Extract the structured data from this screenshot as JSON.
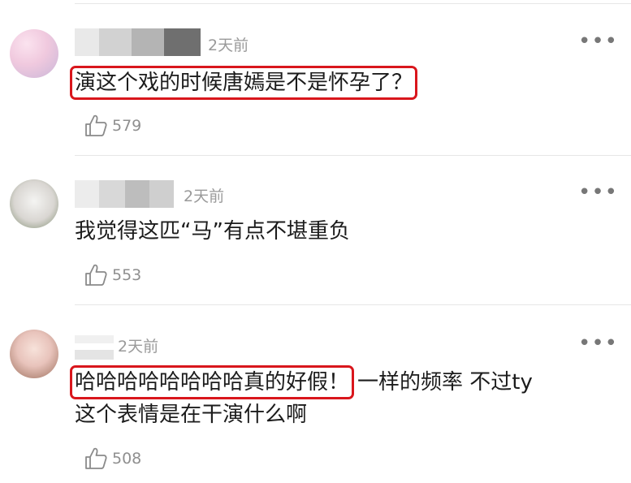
{
  "comments": [
    {
      "time": "2天前",
      "text_highlight": "演这个戏的时候唐嫣是不是怀孕了？",
      "text_rest": "",
      "text_line2": "",
      "likes": "579"
    },
    {
      "time": "2天前",
      "text_highlight": "",
      "text_rest": "我觉得这匹“马”有点不堪重负",
      "text_line2": "",
      "likes": "553"
    },
    {
      "time": "2天前",
      "text_highlight": "哈哈哈哈哈哈哈哈真的好假！",
      "text_rest": "一样的频率 不过ty",
      "text_line2": "这个表情是在干演什么啊",
      "likes": "508"
    }
  ],
  "icons": {
    "more": "more-options-icon",
    "like": "thumbs-up-icon"
  },
  "colors": {
    "highlight_box": "#d9161c",
    "meta_text": "#9a9a9a"
  }
}
